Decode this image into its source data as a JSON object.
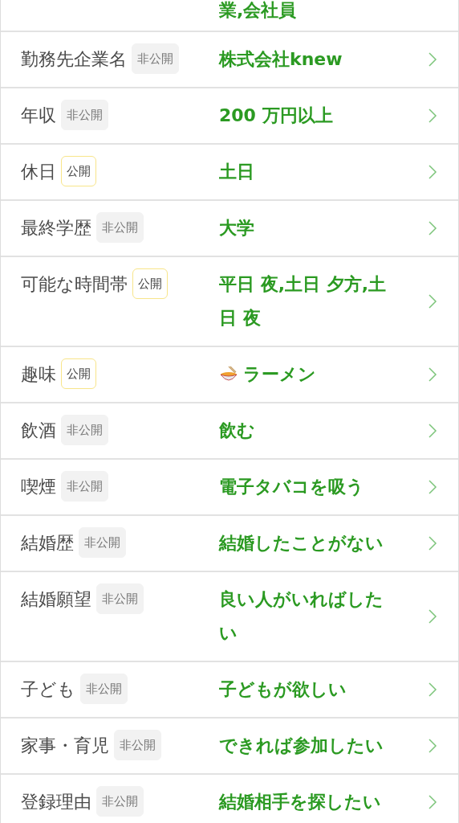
{
  "rows": [
    {
      "kind": "partial",
      "label": "",
      "value": "業,会社員"
    },
    {
      "kind": "text",
      "label": "勤務先企業名",
      "badge": {
        "text": "非公開",
        "public": false
      },
      "value": "株式会社knew"
    },
    {
      "kind": "text",
      "label": "年収",
      "badge": {
        "text": "非公開",
        "public": false
      },
      "value": "200 万円以上"
    },
    {
      "kind": "text",
      "label": "休日",
      "badge": {
        "text": "公開",
        "public": true
      },
      "value": "土日"
    },
    {
      "kind": "text",
      "label": "最終学歴",
      "badge": {
        "text": "非公開",
        "public": false
      },
      "value": "大学"
    },
    {
      "kind": "text",
      "label": "可能な時間帯",
      "badge": {
        "text": "公開",
        "public": true
      },
      "value": "平日 夜,土日 夕方,土日 夜"
    },
    {
      "kind": "emoji",
      "label": "趣味",
      "badge": {
        "text": "公開",
        "public": true
      },
      "value": "ラーメン"
    },
    {
      "kind": "text",
      "label": "飲酒",
      "badge": {
        "text": "非公開",
        "public": false
      },
      "value": "飲む"
    },
    {
      "kind": "text",
      "label": "喫煙",
      "badge": {
        "text": "非公開",
        "public": false
      },
      "value": "電子タバコを吸う"
    },
    {
      "kind": "text",
      "label": "結婚歴",
      "badge": {
        "text": "非公開",
        "public": false
      },
      "value": "結婚したことがない"
    },
    {
      "kind": "text",
      "label": "結婚願望",
      "badge": {
        "text": "非公開",
        "public": false
      },
      "value": "良い人がいればしたい"
    },
    {
      "kind": "text",
      "label": "子ども",
      "badge": {
        "text": "非公開",
        "public": false
      },
      "value": "子どもが欲しい"
    },
    {
      "kind": "text",
      "label": "家事・育児",
      "badge": {
        "text": "非公開",
        "public": false
      },
      "value": "できれば参加したい"
    },
    {
      "kind": "text",
      "label": "登録理由",
      "badge": {
        "text": "非公開",
        "public": false
      },
      "value": "結婚相手を探したい"
    }
  ]
}
